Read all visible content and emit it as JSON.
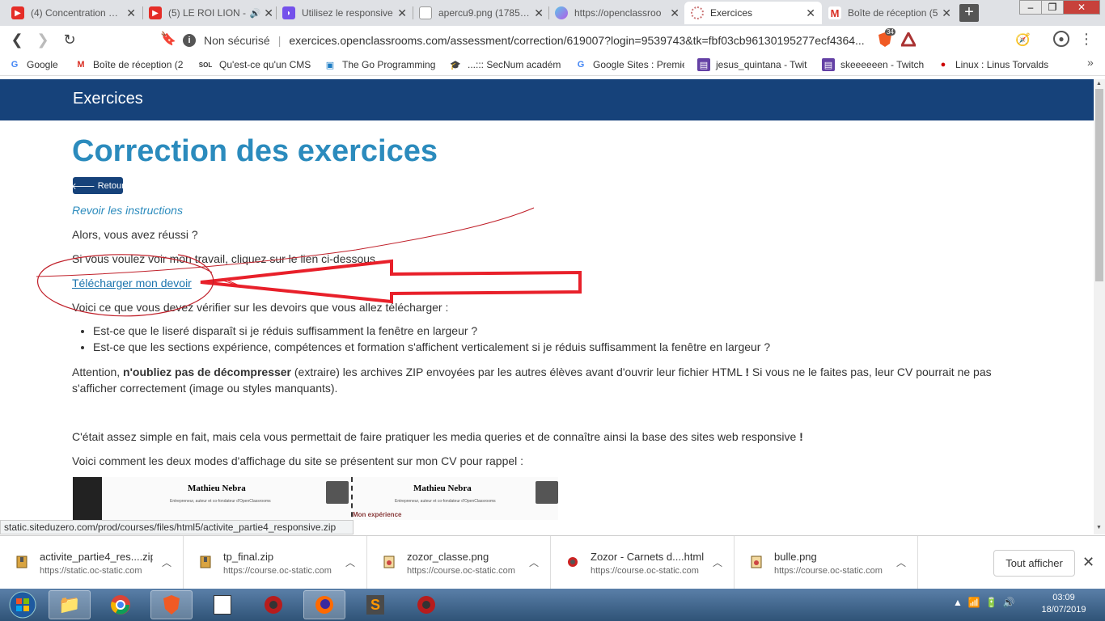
{
  "tabs": [
    {
      "title": "(4) Concentration Pro",
      "icon": "youtube-icon"
    },
    {
      "title": "(5) LE ROI LION -",
      "icon": "youtube-icon"
    },
    {
      "title": "Utilisez le responsive",
      "icon": "openclassrooms-icon"
    },
    {
      "title": "apercu9.png (1785×5",
      "icon": "page-icon"
    },
    {
      "title": "https://openclassroo",
      "icon": "qwant-icon"
    },
    {
      "title": "Exercices",
      "icon": "loading-icon"
    },
    {
      "title": "Boîte de réception (5",
      "icon": "gmail-icon"
    }
  ],
  "address": {
    "security": "Non sécurisé",
    "url": "exercices.openclassrooms.com/assessment/correction/619007?login=9539743&tk=fbf03cb96130195277ecf4364..."
  },
  "extension_badge": "34",
  "bookmarks": [
    "Google",
    "Boîte de réception (2",
    "Qu'est-ce qu'un CMS",
    "The Go Programming",
    "...::: SecNum académ",
    "Google Sites : Premie",
    "jesus_quintana - Twit",
    "skeeeeeen - Twitch",
    "Linux : Linus Torvalds"
  ],
  "header_title": "Exercices",
  "page": {
    "title": "Correction des exercices",
    "back_label": "Retour",
    "review_link": "Revoir les instructions",
    "p1": "Alors, vous avez réussi ?",
    "p2": "Si vous voulez voir mon travail, cliquez sur le lien ci-dessous",
    "download_link": "Télécharger mon devoir",
    "p3": "Voici ce que vous devez vérifier sur les devoirs que vous allez télécharger :",
    "bullets": [
      "Est-ce que le liseré disparaît si je réduis suffisamment la fenêtre en largeur ?",
      "Est-ce que les sections expérience, compétences et formation s'affichent verticalement si je réduis suffisamment la fenêtre en largeur ?"
    ],
    "warn_a": "Attention, ",
    "warn_b": "n'oubliez pas de décompresser",
    "warn_c": " (extraire) les archives ZIP envoyées par les autres élèves avant d'ouvrir leur fichier HTML ",
    "warn_d": "!",
    "warn_e": " Si vous ne le faites pas, leur CV pourrait ne pas",
    "warn_f": "s'afficher correctement (image ou styles manquants).",
    "p4a": "C'était assez simple en fait, mais cela vous permettait de faire pratiquer les media queries et de connaître ainsi la base des sites web responsive ",
    "p4b": "!",
    "p5": "Voici comment les deux modes d'affichage du site se présentent sur mon CV pour rappel :",
    "cv_name": "Mathieu Nebra",
    "cv_sub": "Entrepreneur, auteur et co-fondateur d'OpenClassrooms",
    "cv_section": "Mon expérience"
  },
  "status_url": "static.siteduzero.com/prod/courses/files/html5/activite_partie4_responsive.zip",
  "downloads": [
    {
      "name": "activite_partie4_res....zip",
      "source": "https://static.oc-static.com",
      "icon": "zip-icon"
    },
    {
      "name": "tp_final.zip",
      "source": "https://course.oc-static.com",
      "icon": "zip-icon"
    },
    {
      "name": "zozor_classe.png",
      "source": "https://course.oc-static.com",
      "icon": "image-icon"
    },
    {
      "name": "Zozor - Carnets d....html",
      "source": "https://course.oc-static.com",
      "icon": "html-icon"
    },
    {
      "name": "bulle.png",
      "source": "https://course.oc-static.com",
      "icon": "image-icon"
    }
  ],
  "show_all": "Tout afficher",
  "clock": {
    "time": "03:09",
    "date": "18/07/2019"
  },
  "colors": {
    "header": "#16427a",
    "title": "#2b8bbd",
    "annotation": "#e8202a"
  }
}
